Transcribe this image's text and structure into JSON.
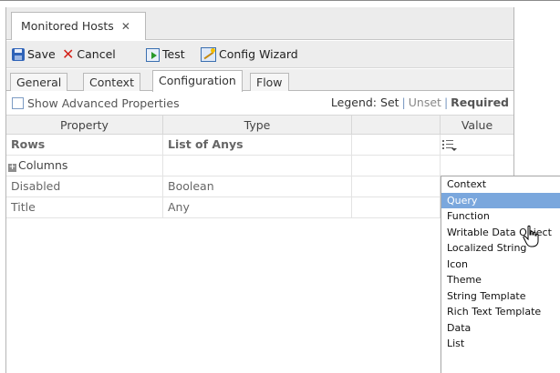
{
  "window": {
    "tab_title": "Monitored Hosts",
    "close_glyph": "✕"
  },
  "toolbar": {
    "save_label": "Save",
    "cancel_label": "Cancel",
    "test_label": "Test",
    "wizard_label": "Config Wizard"
  },
  "tabs": [
    {
      "label": "General"
    },
    {
      "label": "Context"
    },
    {
      "label": "Configuration",
      "active": true
    },
    {
      "label": "Flow"
    }
  ],
  "options": {
    "show_advanced_label": "Show Advanced Properties",
    "show_advanced_checked": false,
    "legend_prefix": "Legend:",
    "legend_set": "Set",
    "legend_sep": "|",
    "legend_unset": "Unset",
    "legend_required": "Required"
  },
  "table": {
    "headers": {
      "property": "Property",
      "type": "Type",
      "value": "Value"
    },
    "rows": [
      {
        "property": "Rows",
        "type": "List of Anys",
        "required": true
      },
      {
        "property": "Columns",
        "type": "",
        "expandable": true
      },
      {
        "property": "Disabled",
        "type": "Boolean"
      },
      {
        "property": "Title",
        "type": "Any"
      }
    ]
  },
  "menu": {
    "items": [
      "Context",
      "Query",
      "Function",
      "Writable Data Object",
      "Localized String",
      "Icon",
      "Theme",
      "String Template",
      "Rich Text Template",
      "Data",
      "List"
    ],
    "highlighted": "Query"
  },
  "colors": {
    "menu_highlight": "#7aa7dd",
    "cancel_icon": "#d3221a",
    "save_icon": "#2f63b8"
  },
  "icons": {
    "save": "save-icon",
    "cancel": "cancel-icon",
    "test": "test-icon",
    "wizard": "config-wizard-icon",
    "value_picker": "value-picker-icon",
    "cursor": "hand-pointer-icon"
  }
}
